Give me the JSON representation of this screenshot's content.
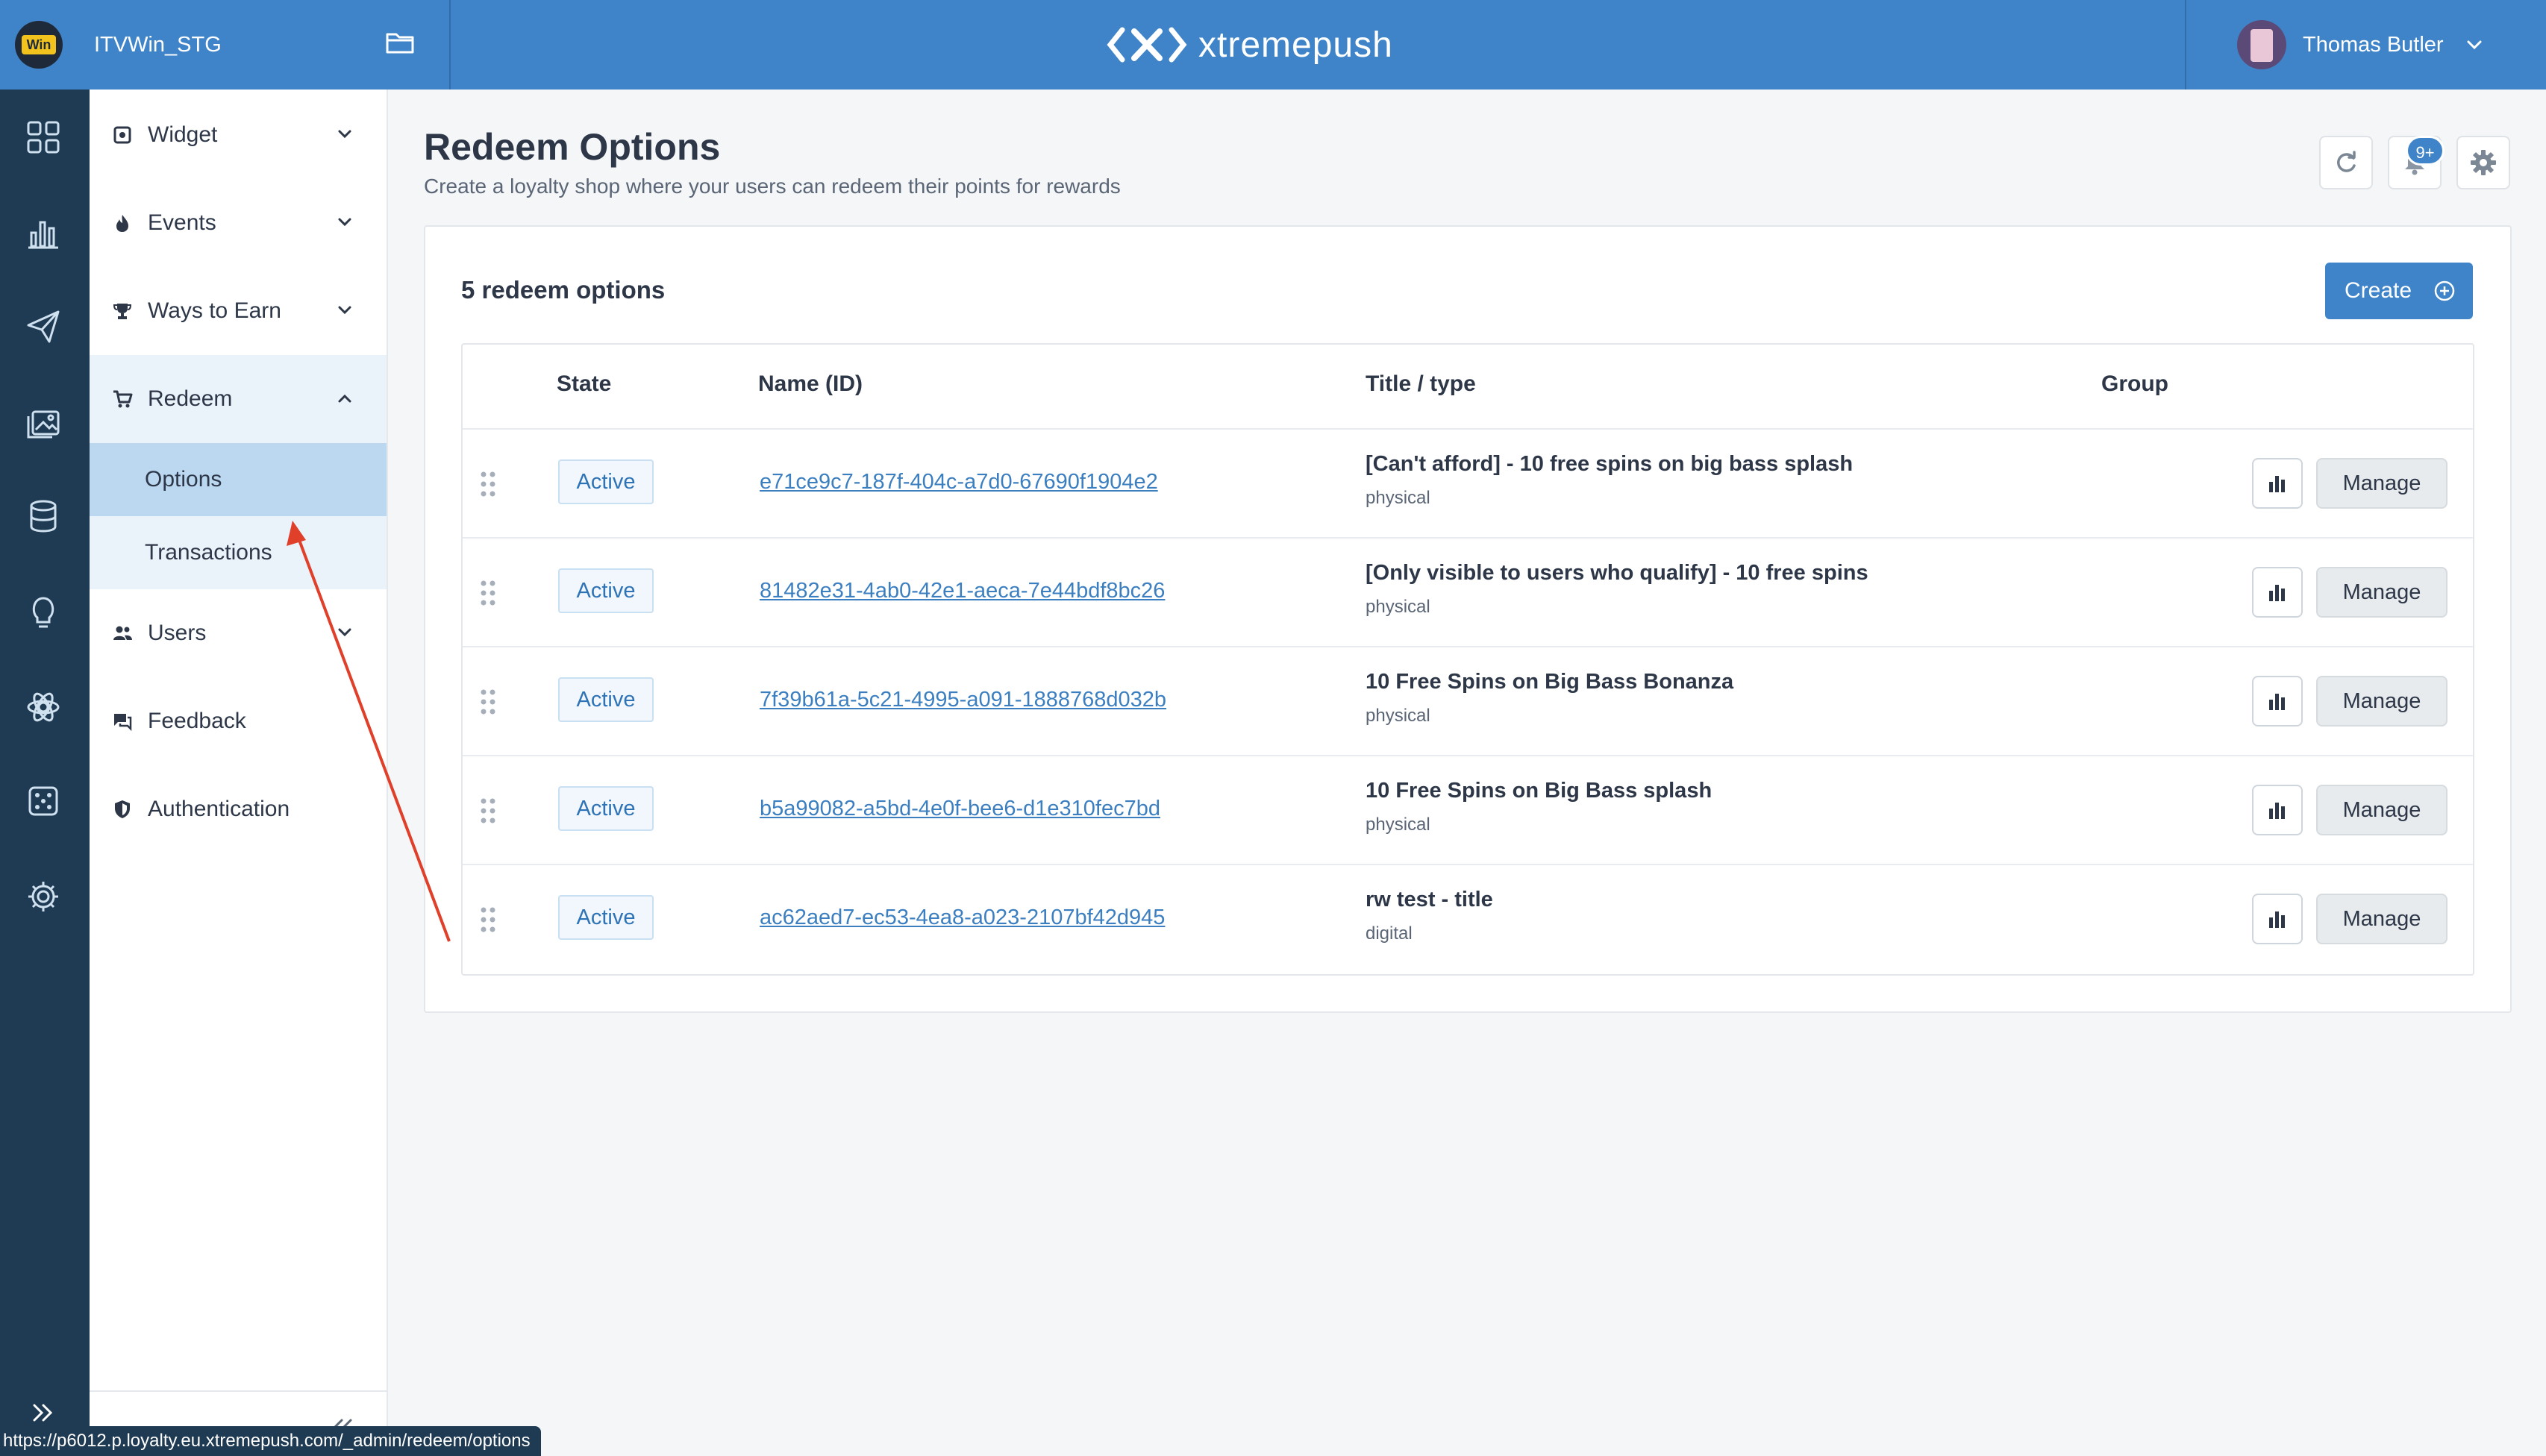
{
  "project": {
    "name": "ITVWin_STG",
    "logo_text": "Win"
  },
  "brand": {
    "name": "xtremepush"
  },
  "user": {
    "name": "Thomas Butler"
  },
  "rail": {
    "icons": [
      "dashboard-icon",
      "analytics-icon",
      "campaigns-icon",
      "content-icon",
      "data-icon",
      "ideas-icon",
      "integrations-icon",
      "games-icon",
      "settings-icon"
    ]
  },
  "sidebar": {
    "items": [
      {
        "label": "Widget",
        "icon": "widget-icon"
      },
      {
        "label": "Events",
        "icon": "flame-icon"
      },
      {
        "label": "Ways to Earn",
        "icon": "trophy-icon"
      },
      {
        "label": "Redeem",
        "icon": "cart-icon"
      },
      {
        "label": "Users",
        "icon": "users-icon"
      },
      {
        "label": "Feedback",
        "icon": "feedback-icon"
      },
      {
        "label": "Authentication",
        "icon": "shield-icon"
      }
    ],
    "sub_items": [
      {
        "label": "Options",
        "active": true
      },
      {
        "label": "Transactions",
        "active": false
      }
    ]
  },
  "page": {
    "title": "Redeem Options",
    "subtitle": "Create a loyalty shop where your users can redeem their points for rewards",
    "notifications_badge": "9+"
  },
  "panel": {
    "count_title": "5 redeem options",
    "create_label": "Create"
  },
  "table": {
    "headers": [
      "State",
      "Name (ID)",
      "Title / type",
      "Group"
    ],
    "rows": [
      {
        "state": "Active",
        "id": "e71ce9c7-187f-404c-a7d0-67690f1904e2",
        "title": "[Can't afford] - 10 free spins on big bass splash",
        "type": "physical",
        "manage": "Manage"
      },
      {
        "state": "Active",
        "id": "81482e31-4ab0-42e1-aeca-7e44bdf8bc26",
        "title": "[Only visible to users who qualify] - 10 free spins",
        "type": "physical",
        "manage": "Manage"
      },
      {
        "state": "Active",
        "id": "7f39b61a-5c21-4995-a091-1888768d032b",
        "title": "10 Free Spins on Big Bass Bonanza",
        "type": "physical",
        "manage": "Manage"
      },
      {
        "state": "Active",
        "id": "b5a99082-a5bd-4e0f-bee6-d1e310fec7bd",
        "title": "10 Free Spins on Big Bass splash",
        "type": "physical",
        "manage": "Manage"
      },
      {
        "state": "Active",
        "id": "ac62aed7-ec53-4ea8-a023-2107bf42d945",
        "title": "rw test - title",
        "type": "digital",
        "manage": "Manage"
      }
    ]
  },
  "status_bar": {
    "url": "https://p6012.p.loyalty.eu.xtremepush.com/_admin/redeem/options"
  },
  "colors": {
    "topbar": "#3f84c8",
    "rail": "#1f3a53",
    "accent": "#3f84c8",
    "annotation_arrow": "#e0402a"
  }
}
